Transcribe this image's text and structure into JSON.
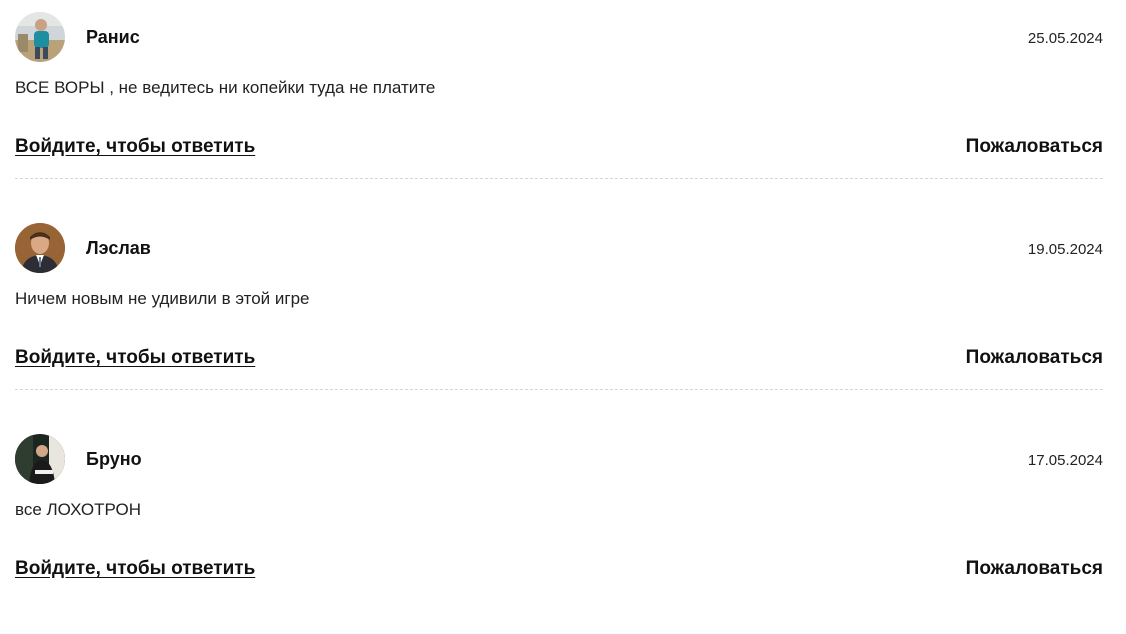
{
  "comments": [
    {
      "author": "Ранис",
      "date": "25.05.2024",
      "text": "ВСЕ ВОРЫ , не ведитесь ни копейки туда не платите",
      "reply_label": "Войдите, чтобы ответить",
      "report_label": "Пожаловаться",
      "avatar_icon": "user-photo-avatar"
    },
    {
      "author": "Лэслав",
      "date": "19.05.2024",
      "text": "Ничем новым не удивили в этой игре",
      "reply_label": "Войдите, чтобы ответить",
      "report_label": "Пожаловаться",
      "avatar_icon": "user-photo-avatar"
    },
    {
      "author": "Бруно",
      "date": "17.05.2024",
      "text": "все ЛОХОТРОН",
      "reply_label": "Войдите, чтобы ответить",
      "report_label": "Пожаловаться",
      "avatar_icon": "user-photo-avatar"
    }
  ]
}
